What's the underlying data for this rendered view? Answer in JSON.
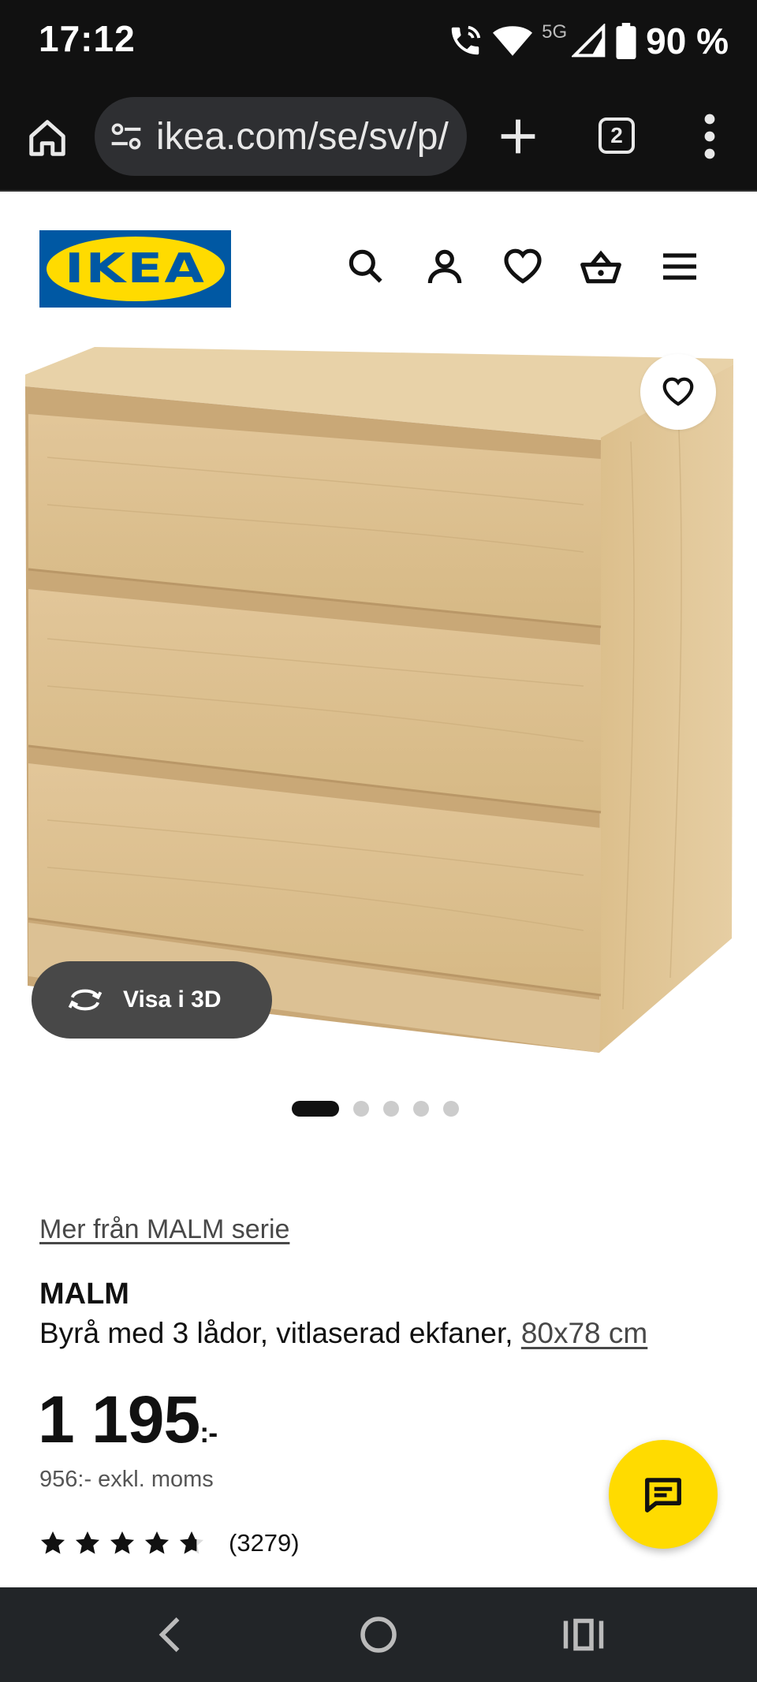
{
  "status_bar": {
    "time": "17:12",
    "network": "5G",
    "battery": "90 %"
  },
  "browser": {
    "url": "ikea.com/se/sv/p/",
    "tab_count": "2"
  },
  "header": {
    "logo_text": "IKEA",
    "logo_mark": "®",
    "icons": [
      "search-icon",
      "account-icon",
      "heart-icon",
      "cart-icon",
      "menu-icon"
    ]
  },
  "gallery": {
    "view_3d_label": "Visa i 3D",
    "image_count": 5,
    "active_index": 0
  },
  "product": {
    "series_link": "Mer från MALM serie",
    "name": "MALM",
    "description": "Byrå med 3 lådor, vitlaserad ekfaner, ",
    "size_link": "80x78 cm",
    "price_main": "1 195",
    "price_suffix": ":-",
    "price_ex_vat": "956:- exkl. moms",
    "rating": 4.5,
    "review_count": "(3279)"
  },
  "colors": {
    "ikea_blue": "#0058a3",
    "ikea_yellow": "#ffdb00",
    "wood": "#dcbf8e"
  }
}
